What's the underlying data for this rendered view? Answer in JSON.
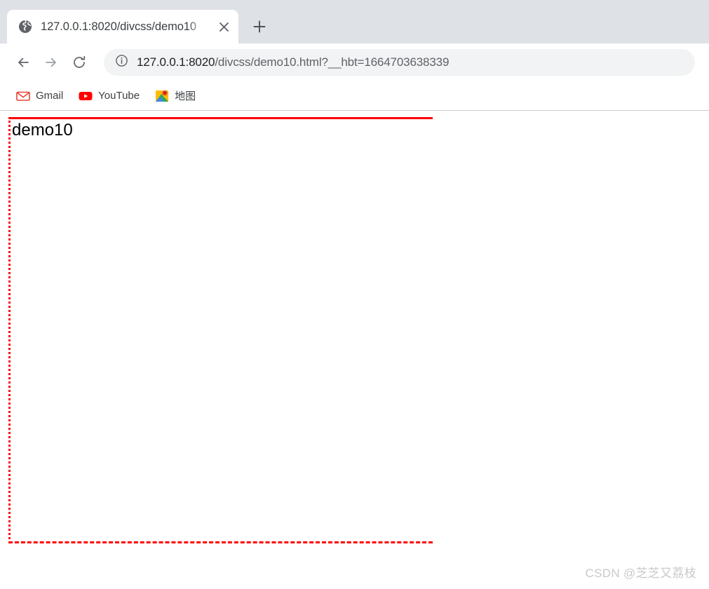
{
  "browser": {
    "tab": {
      "favicon_icon": "globe-icon",
      "title": "127.0.0.1:8020/divcss/demo10",
      "close_label": "×"
    },
    "newtab_label": "+",
    "toolbar": {
      "back_icon": "arrow-left-icon",
      "forward_icon": "arrow-right-icon",
      "reload_icon": "reload-icon",
      "info_icon": "info-circle-icon",
      "url_main": "127.0.0.1:8020",
      "url_rest": "/divcss/demo10.html?__hbt=1664703638339",
      "url_full": "127.0.0.1:8020/divcss/demo10.html?__hbt=1664703638339"
    },
    "bookmarks": [
      {
        "label": "Gmail",
        "icon": "gmail-icon"
      },
      {
        "label": "YouTube",
        "icon": "youtube-icon"
      },
      {
        "label": "地图",
        "icon": "google-maps-icon"
      }
    ]
  },
  "page": {
    "heading": "demo10",
    "box": {
      "border_color": "#ff0000",
      "border_top_style": "solid",
      "border_left_style": "dotted",
      "border_bottom_style": "dashed",
      "border_right_style": "none",
      "border_width": "3px"
    },
    "watermark": "CSDN @芝芝又荔枝"
  }
}
